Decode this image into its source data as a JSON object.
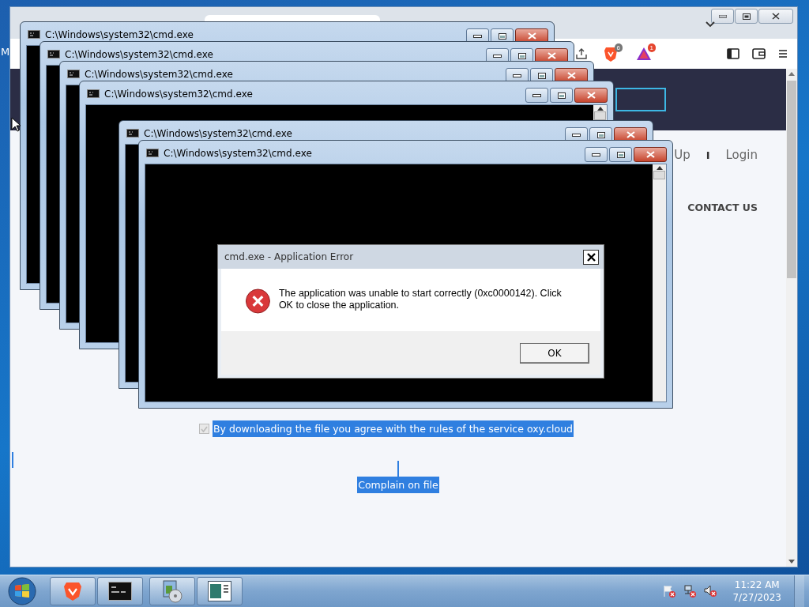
{
  "desktop": {
    "edge_text": "M"
  },
  "browser": {
    "badges": [
      {
        "kind": "shields",
        "count": "6"
      },
      {
        "kind": "rewards",
        "count": "1"
      }
    ],
    "page": {
      "nav": [
        {
          "kind": "link",
          "text": "Up"
        },
        {
          "kind": "separator",
          "text": "I"
        },
        {
          "kind": "link",
          "text": "Login"
        }
      ],
      "menu_item": "CONTACT US",
      "agreement": {
        "checked": true,
        "disabled": true,
        "highlighted": true,
        "text": "By downloading the file you agree with the rules of the service oxy.cloud"
      },
      "complain_link": {
        "highlighted": true,
        "text": "Complain on file"
      }
    }
  },
  "consoles": [
    {
      "title": "C:\\Windows\\system32\\cmd.exe"
    },
    {
      "title": "C:\\Windows\\system32\\cmd.exe"
    },
    {
      "title": "C:\\Windows\\system32\\cmd.exe"
    },
    {
      "title": "C:\\Windows\\system32\\cmd.exe"
    },
    {
      "title": "C:\\Windows\\system32\\cmd.exe"
    },
    {
      "title": "C:\\Windows\\system32\\cmd.exe"
    }
  ],
  "error_dialog": {
    "title": "cmd.exe - Application Error",
    "message": "The application was unable to start correctly (0xc0000142). Click OK to close the application.",
    "button": "OK"
  },
  "taskbar": {
    "apps": [
      {
        "kind": "brave"
      },
      {
        "kind": "console"
      },
      {
        "kind": "installer"
      },
      {
        "kind": "document"
      }
    ],
    "tray": {
      "icons": [
        {
          "kind": "flag"
        },
        {
          "kind": "network"
        },
        {
          "kind": "speaker"
        }
      ],
      "time": "11:22 AM",
      "date": "7/27/2023"
    }
  }
}
